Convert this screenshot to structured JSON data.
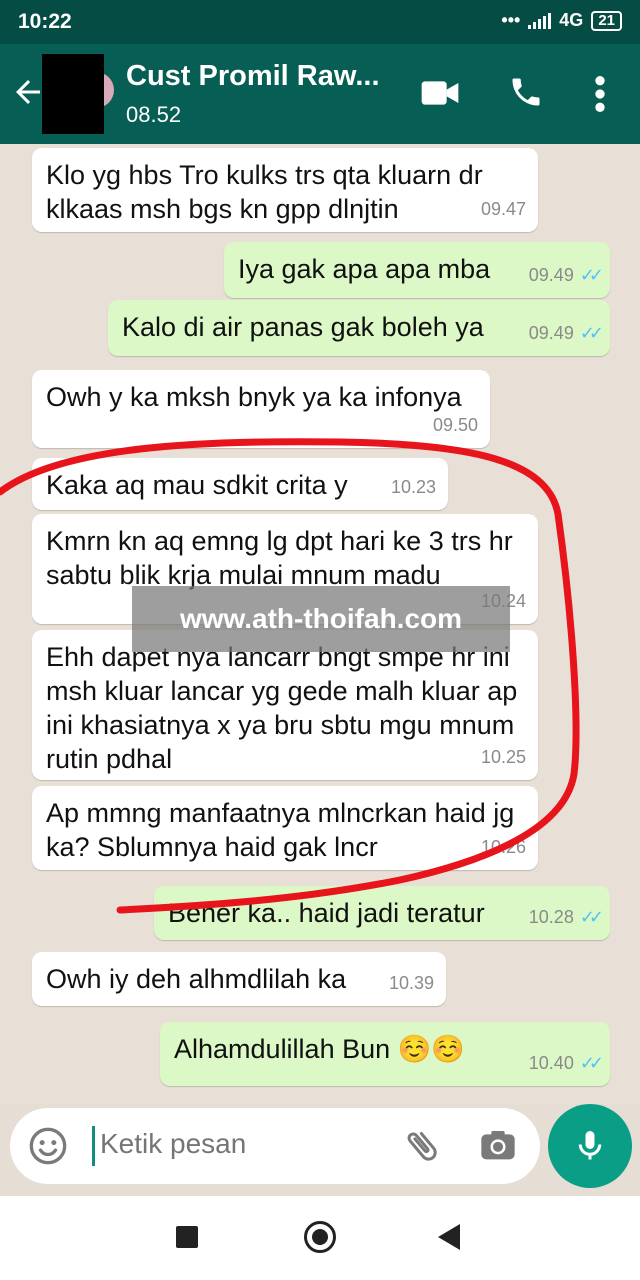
{
  "status_bar": {
    "time": "10:22",
    "network": "4G",
    "battery": "21"
  },
  "header": {
    "title": "Cust Promil Raw...",
    "subtitle": "08.52"
  },
  "messages": [
    {
      "dir": "in",
      "text": "Klo yg hbs Tro kulks trs qta kluarn dr klkaas msh bgs kn gpp dlnjtin",
      "time": "09.47"
    },
    {
      "dir": "out",
      "text": "Iya gak apa apa mba",
      "time": "09.49",
      "status": "read"
    },
    {
      "dir": "out",
      "text": "Kalo di air panas gak boleh ya",
      "time": "09.49",
      "status": "read"
    },
    {
      "dir": "in",
      "text": "Owh y ka mksh bnyk ya ka infonya",
      "time": "09.50"
    },
    {
      "dir": "in",
      "text": "Kaka aq mau sdkit crita y",
      "time": "10.23"
    },
    {
      "dir": "in",
      "text": "Kmrn kn aq emng lg dpt hari ke 3 trs hr sabtu blik krja mulai mnum madu",
      "time": "10.24"
    },
    {
      "dir": "in",
      "text": "Ehh dapet nya lancarr bngt smpe hr ini msh kluar lancar yg gede malh kluar ap ini khasiatnya x ya bru  sbtu mgu mnum rutin pdhal",
      "time": "10.25"
    },
    {
      "dir": "in",
      "text": "Ap mmng manfaatnya mlncrkan haid jg ka? Sblumnya haid gak lncr",
      "time": "10.26"
    },
    {
      "dir": "out",
      "text": "Bener ka.. haid jadi teratur",
      "time": "10.28",
      "status": "read"
    },
    {
      "dir": "in",
      "text": "Owh iy deh alhmdlilah ka",
      "time": "10.39"
    },
    {
      "dir": "out",
      "text": "Alhamdulillah Bun ☺️☺️",
      "time": "10.40",
      "status": "read"
    }
  ],
  "watermark": "www.ath-thoifah.com",
  "composer": {
    "placeholder": "Ketik pesan"
  },
  "icons": [
    "back-arrow-icon",
    "video-call-icon",
    "phone-icon",
    "more-vert-icon",
    "emoji-icon",
    "attach-icon",
    "camera-icon",
    "mic-icon"
  ],
  "colors": {
    "header": "#075e54",
    "status_bar": "#054d44",
    "outgoing_bubble": "#dcf8c6",
    "incoming_bubble": "#ffffff",
    "read_ticks": "#4fc3f7",
    "mic_button": "#0a9e86",
    "annotation": "#e8141b"
  }
}
